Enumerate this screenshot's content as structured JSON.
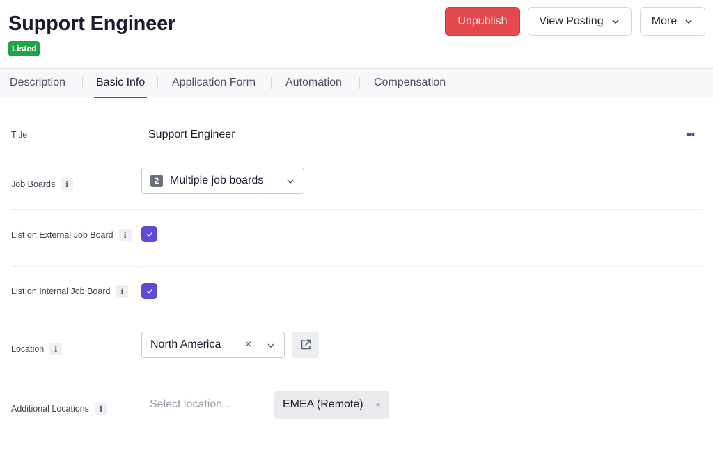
{
  "header": {
    "title": "Support Engineer",
    "status_badge": "Listed",
    "unpublish_label": "Unpublish",
    "view_posting_label": "View Posting",
    "more_label": "More"
  },
  "tabs": [
    {
      "label": "Description",
      "active": false
    },
    {
      "label": "Basic Info",
      "active": true
    },
    {
      "label": "Application Form",
      "active": false
    },
    {
      "label": "Automation",
      "active": false
    },
    {
      "label": "Compensation",
      "active": false
    }
  ],
  "fields": {
    "title": {
      "label": "Title",
      "value": "Support Engineer"
    },
    "job_boards": {
      "label": "Job Boards",
      "count": "2",
      "value": "Multiple job boards"
    },
    "external": {
      "label": "List on External Job Board",
      "checked": true
    },
    "internal": {
      "label": "List on Internal Job Board",
      "checked": true
    },
    "location": {
      "label": "Location",
      "value": "North America",
      "clear": "×"
    },
    "additional_locations": {
      "label": "Additional Locations",
      "placeholder": "Select location...",
      "chips": [
        "EMEA (Remote)"
      ],
      "chip_remove": "×"
    }
  },
  "icons": {
    "info": "i",
    "more": "•••"
  },
  "colors": {
    "accent": "#5b4bd6",
    "danger": "#e5484d",
    "success": "#22a34a"
  }
}
